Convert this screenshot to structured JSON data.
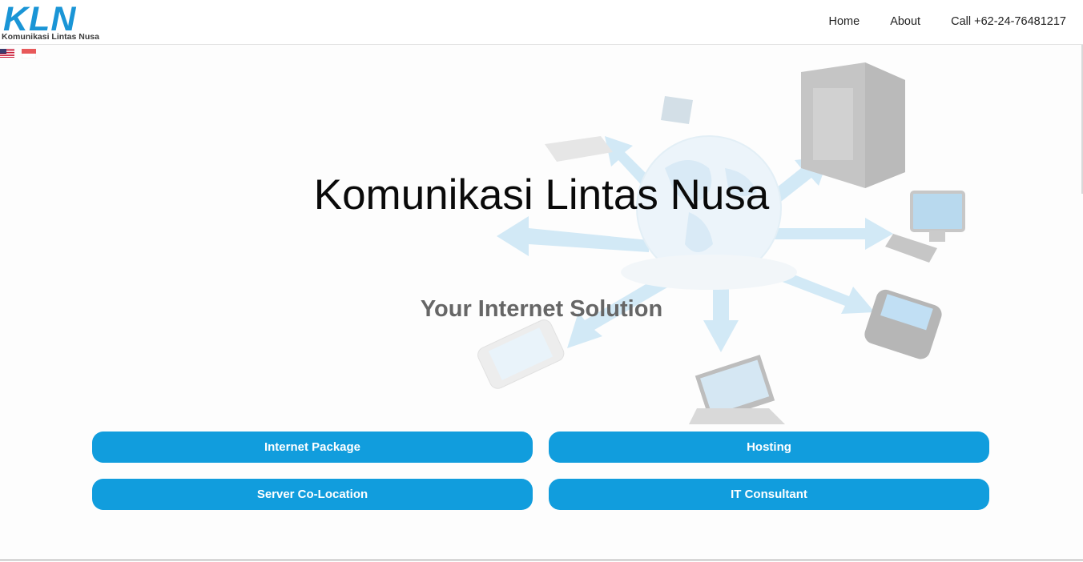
{
  "brand": {
    "logo_text": "KLN",
    "logo_subtitle": "Komunikasi Lintas Nusa",
    "brand_color": "#1a95d6"
  },
  "nav": {
    "items": [
      {
        "label": "Home"
      },
      {
        "label": "About"
      },
      {
        "label": "Call +62-24-76481217"
      }
    ]
  },
  "languages": {
    "options": [
      "flag-us-icon",
      "flag-id-icon"
    ]
  },
  "hero": {
    "title": "Komunikasi Lintas Nusa",
    "subtitle": "Your Internet Solution"
  },
  "services": {
    "buttons": [
      {
        "label": "Internet Package"
      },
      {
        "label": "Hosting"
      },
      {
        "label": "Server Co-Location"
      },
      {
        "label": "IT Consultant"
      }
    ]
  },
  "colors": {
    "button": "#119ddd",
    "title": "#0a0a0a",
    "subtitle": "#666666"
  }
}
